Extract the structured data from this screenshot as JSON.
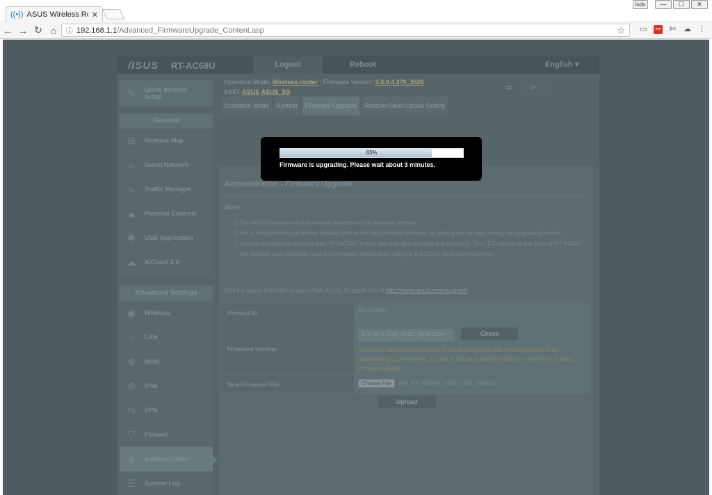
{
  "browser": {
    "tab_title": "ASUS Wireless Router RT",
    "tab_close": "✕",
    "url_host": "192.168.1.1",
    "url_path": "/Advanced_FirmwareUpgrade_Content.asp",
    "win_user": "ludo",
    "win_min": "—",
    "win_max": "☐",
    "win_close": "✕"
  },
  "router": {
    "logo": "/ISUS",
    "model": "RT-AC68U",
    "topbar": {
      "logout": "Logout",
      "reboot": "Reboot",
      "language": "English ▾"
    },
    "info": {
      "op_mode_label": "Operation Mode:",
      "op_mode": "Wireless router",
      "fw_label": "Firmware Version:",
      "fw_version": "3.0.0.4.376_3626",
      "ssid_label": "SSID:",
      "ssid1": "ASUS",
      "ssid2": "ASUS_5G"
    },
    "subtabs": [
      "Operation Mode",
      "System",
      "Firmware Upgrade",
      "Restore/Save/Upload Setting"
    ],
    "sidebar": {
      "quick_setup": "Quick Internet Setup",
      "general_title": "General",
      "general_items": [
        "Network Map",
        "Guest Network",
        "Traffic Manager",
        "Parental Controls",
        "USB Application",
        "AiCloud 2.0"
      ],
      "advanced_title": "Advanced Settings",
      "advanced_items": [
        "Wireless",
        "LAN",
        "WAN",
        "IPv6",
        "VPN",
        "Firewall",
        "Administration",
        "System Log"
      ]
    },
    "content": {
      "title": "Administration - Firmware Upgrade",
      "note_label": "Note:",
      "notes": [
        "The latest firmware version include updates on the previous version.",
        "For a configuration parameter existing both in the old and new firmware, its setting will be kept during the upgrade process.",
        "In case the upgrade process fails, RT-AC68U enters the emergency mode automatically. The LED signals at the front of RT-AC68U will indicate such situation. Use the Firmware Restoration utility on the CD to do system recovery."
      ],
      "support_text": "Get the latest firmware version from ASUS Support site at",
      "support_link": "http://www.asus.com/support/",
      "product_id_label": "Product ID",
      "product_id": "RT-AC68U",
      "fw_version_label": "Firmware Version",
      "fw_version_value": "3.0.0.4.376_3626-g9a8323e",
      "check_button": "Check",
      "check_warning": "The router cannot connect to ASUS server to check for the firmware update. After reconnecting to the Internet, go back to this page and click Check to check for the latest firmware updates.",
      "new_fw_label": "New Firmware File",
      "choose_file": "Choose File",
      "file_name": "FW_RT_AC68U_3.0.0.4_382_18991.trx",
      "upload_button": "Upload"
    }
  },
  "modal": {
    "progress_percent": 83,
    "progress_text": "83%",
    "message": "Firmware is upgrading. Please wait about 3 minutes."
  }
}
